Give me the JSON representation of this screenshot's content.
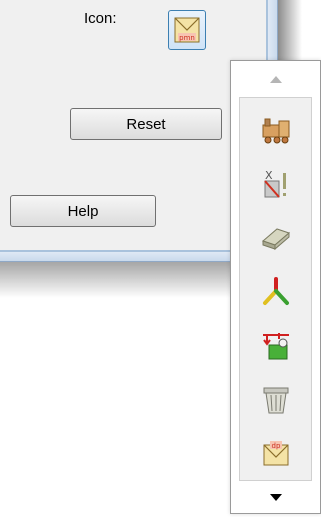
{
  "dialog": {
    "icon_label": "Icon:",
    "reset_label": "Reset",
    "help_label": "Help"
  },
  "palette": {
    "scroll_up_icon": "triangle-up-icon",
    "scroll_down_icon": "triangle-down-icon",
    "items": [
      {
        "name": "train-icon"
      },
      {
        "name": "x-exclaim-icon"
      },
      {
        "name": "eraser-icon"
      },
      {
        "name": "branch-icon"
      },
      {
        "name": "green-device-icon"
      },
      {
        "name": "basket-icon"
      },
      {
        "name": "dp-envelope-icon"
      }
    ]
  },
  "colors": {
    "accent_border": "#3c7fb1",
    "frame_blue": "#a9c2dc"
  }
}
